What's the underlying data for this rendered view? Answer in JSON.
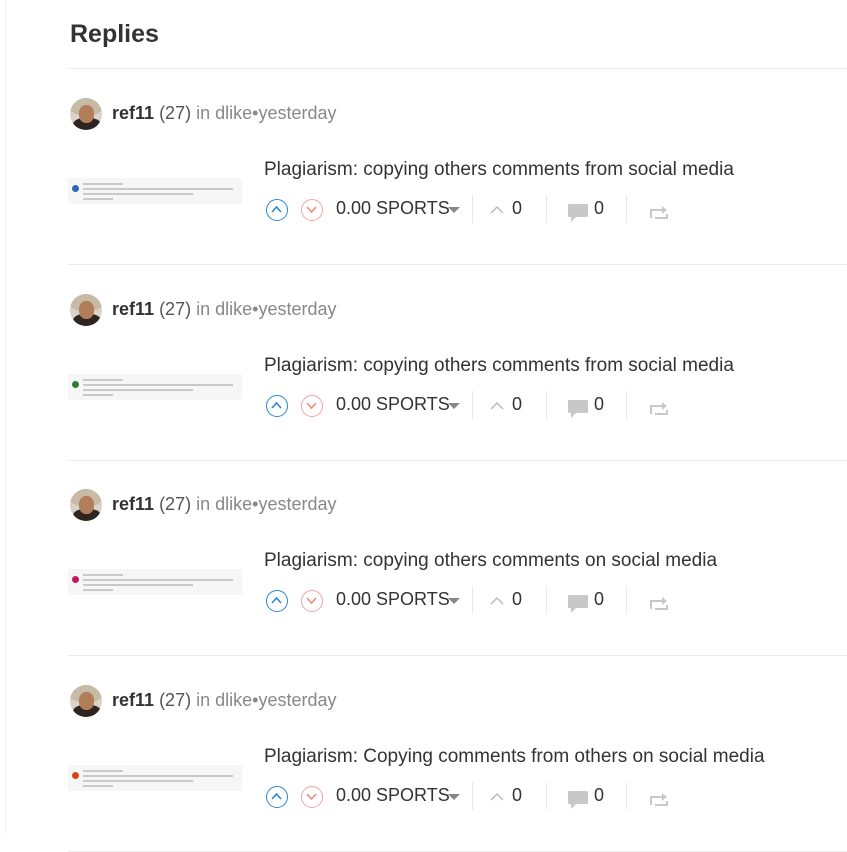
{
  "header": {
    "title": "Replies"
  },
  "replies": [
    {
      "author": "ref11",
      "reputation": "(27)",
      "in_label": "in",
      "community": "dlike",
      "bullet": "•",
      "time": "yesterday",
      "title": "Plagiarism: copying others comments from social media",
      "payout": "0.00 SPORTS",
      "likes": "0",
      "comments": "0",
      "thumb_dot_color": "#2f63b8"
    },
    {
      "author": "ref11",
      "reputation": "(27)",
      "in_label": "in",
      "community": "dlike",
      "bullet": "•",
      "time": "yesterday",
      "title": "Plagiarism: copying others comments from social media",
      "payout": "0.00 SPORTS",
      "likes": "0",
      "comments": "0",
      "thumb_dot_color": "#2e7d32"
    },
    {
      "author": "ref11",
      "reputation": "(27)",
      "in_label": "in",
      "community": "dlike",
      "bullet": "•",
      "time": "yesterday",
      "title": "Plagiarism: copying others comments on social media",
      "payout": "0.00 SPORTS",
      "likes": "0",
      "comments": "0",
      "thumb_dot_color": "#c2185b"
    },
    {
      "author": "ref11",
      "reputation": "(27)",
      "in_label": "in",
      "community": "dlike",
      "bullet": "•",
      "time": "yesterday",
      "title": "Plagiarism: Copying comments from others on social media",
      "payout": "0.00 SPORTS",
      "likes": "0",
      "comments": "0",
      "thumb_dot_color": "#d84315"
    }
  ],
  "icons": {
    "upvote": "chevron-up-icon",
    "downvote": "chevron-down-icon",
    "payout_dropdown": "caret-down-icon",
    "likes": "caret-up-icon",
    "comments": "comment-bubble-icon",
    "reblog": "reblog-icon"
  },
  "colors": {
    "upvote": "#2b86d3",
    "downvote": "#f3a3a3",
    "icon_gray": "#c8c8c8"
  }
}
